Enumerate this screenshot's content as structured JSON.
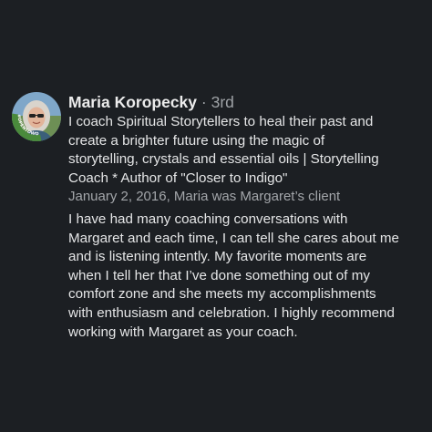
{
  "recommendation": {
    "author": {
      "name": "Maria Koropecky",
      "separator": "·",
      "degree": "3rd",
      "avatar_icon": "profile-photo",
      "avatar_badge_text": "#OPENTOWORK",
      "avatar_badge_color": "#4a8a3c"
    },
    "headline_lines": [
      "I coach Spiritual Storytellers to heal their past and",
      "create a brighter future using the magic of",
      "storytelling, crystals and essential oils | Storytelling",
      "Coach * Author of \"Closer to Indigo\""
    ],
    "meta": "January 2, 2016, Maria was Margaret’s client",
    "body_lines": [
      "I have had many coaching conversations with",
      "Margaret and each time, I can tell she cares about me",
      "and is listening intently. My favorite moments are",
      "when I tell her that I’ve done something out of my",
      "comfort zone and she meets my accomplishments",
      "with enthusiasm and celebration. I highly recommend",
      "working with Margaret as your coach."
    ]
  },
  "colors": {
    "background": "#1c1f23",
    "primary_text": "#e5e6e7",
    "secondary_text": "#a3a6aa"
  }
}
